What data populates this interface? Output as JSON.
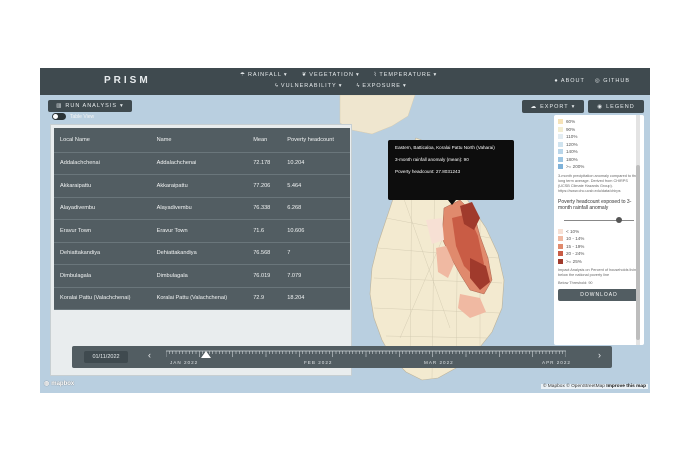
{
  "header": {
    "brand": "PRISM",
    "nav_row1": [
      {
        "label": "RAINFALL",
        "icon": "cloud-rain-icon"
      },
      {
        "label": "VEGETATION",
        "icon": "leaf-icon"
      },
      {
        "label": "TEMPERATURE",
        "icon": "thermometer-icon"
      }
    ],
    "nav_row2": [
      {
        "label": "VULNERABILITY",
        "icon": "bolt-icon"
      },
      {
        "label": "EXPOSURE",
        "icon": "bolt-icon"
      }
    ],
    "about": "ABOUT",
    "github": "GITHUB"
  },
  "analysis": {
    "run_label": "RUN ANALYSIS",
    "table_view_label": "Table View"
  },
  "table": {
    "headers": [
      "Local Name",
      "Name",
      "Mean",
      "Poverty headcount"
    ],
    "rows": [
      [
        "Addalachchenai",
        "Addalachchenai",
        "72.178",
        "10.204"
      ],
      [
        "Akkaraipattu",
        "Akkaraipattu",
        "77.206",
        "5.464"
      ],
      [
        "Alayadivembu",
        "Alayadivembu",
        "76.338",
        "6.268"
      ],
      [
        "Eravur Town",
        "Eravur Town",
        "71.6",
        "10.606"
      ],
      [
        "Dehiattakandiya",
        "Dehiattakandiya",
        "76.568",
        "7"
      ],
      [
        "Dimbulagala",
        "Dimbulagala",
        "76.019",
        "7.079"
      ],
      [
        "Koralai Pattu (Valachchenai)",
        "Koralai Pattu (Valachchenai)",
        "72.9",
        "18.204"
      ]
    ]
  },
  "toolbar": {
    "export_label": "EXPORT",
    "legend_label": "LEGEND"
  },
  "legend": {
    "rainfall_items": [
      {
        "label": "60%",
        "color": "#f6e3b8"
      },
      {
        "label": "90%",
        "color": "#f3eed2"
      },
      {
        "label": "110%",
        "color": "#e2ecf2"
      },
      {
        "label": "120%",
        "color": "#cfe3ef"
      },
      {
        "label": "140%",
        "color": "#b9d6ea"
      },
      {
        "label": "180%",
        "color": "#9dc6e3"
      },
      {
        "label": ">= 200%",
        "color": "#7fb2d9"
      }
    ],
    "rainfall_note": "3-month precipitation anomaly compared to the long term average. Derived from CHIRPS (UCSB Climate Hazards Group). https://www.chc.ucsb.edu/data/chirps",
    "poverty_title": "Poverty headcount exposed to 3-month rainfall anomaly",
    "poverty_items": [
      {
        "label": "< 10%",
        "color": "#f7e0d4"
      },
      {
        "label": "10 - 14%",
        "color": "#f0b9a2"
      },
      {
        "label": "15 - 19%",
        "color": "#e08a6d"
      },
      {
        "label": "20 - 24%",
        "color": "#c95c45"
      },
      {
        "label": ">= 25%",
        "color": "#a03a2c"
      }
    ],
    "poverty_note": "Impact Analysis on Percent of households living below the national poverty line",
    "threshold_label": "Below Threshold: 90",
    "download_label": "DOWNLOAD"
  },
  "tooltip": {
    "location": "Eastern, Batticaloa, Koralai Pattu North (Vaharai)",
    "anomaly": "3-month rainfall anomaly (mean): 90",
    "poverty": "Poverty headcount: 27.8031243"
  },
  "timeline": {
    "date": "01/11/2022",
    "months": [
      "JAN 2022",
      "FEB 2022",
      "MAR 2022",
      "APR 2022"
    ]
  },
  "footer": {
    "mapbox": "mapbox",
    "attribution": "© Mapbox © OpenStreetMap",
    "improve": "Improve this map"
  },
  "colors": {
    "panel_dark": "#3f4a4f",
    "table_row": "#525d62",
    "sea": "#b9cfe0",
    "land": "#f3ead0"
  }
}
